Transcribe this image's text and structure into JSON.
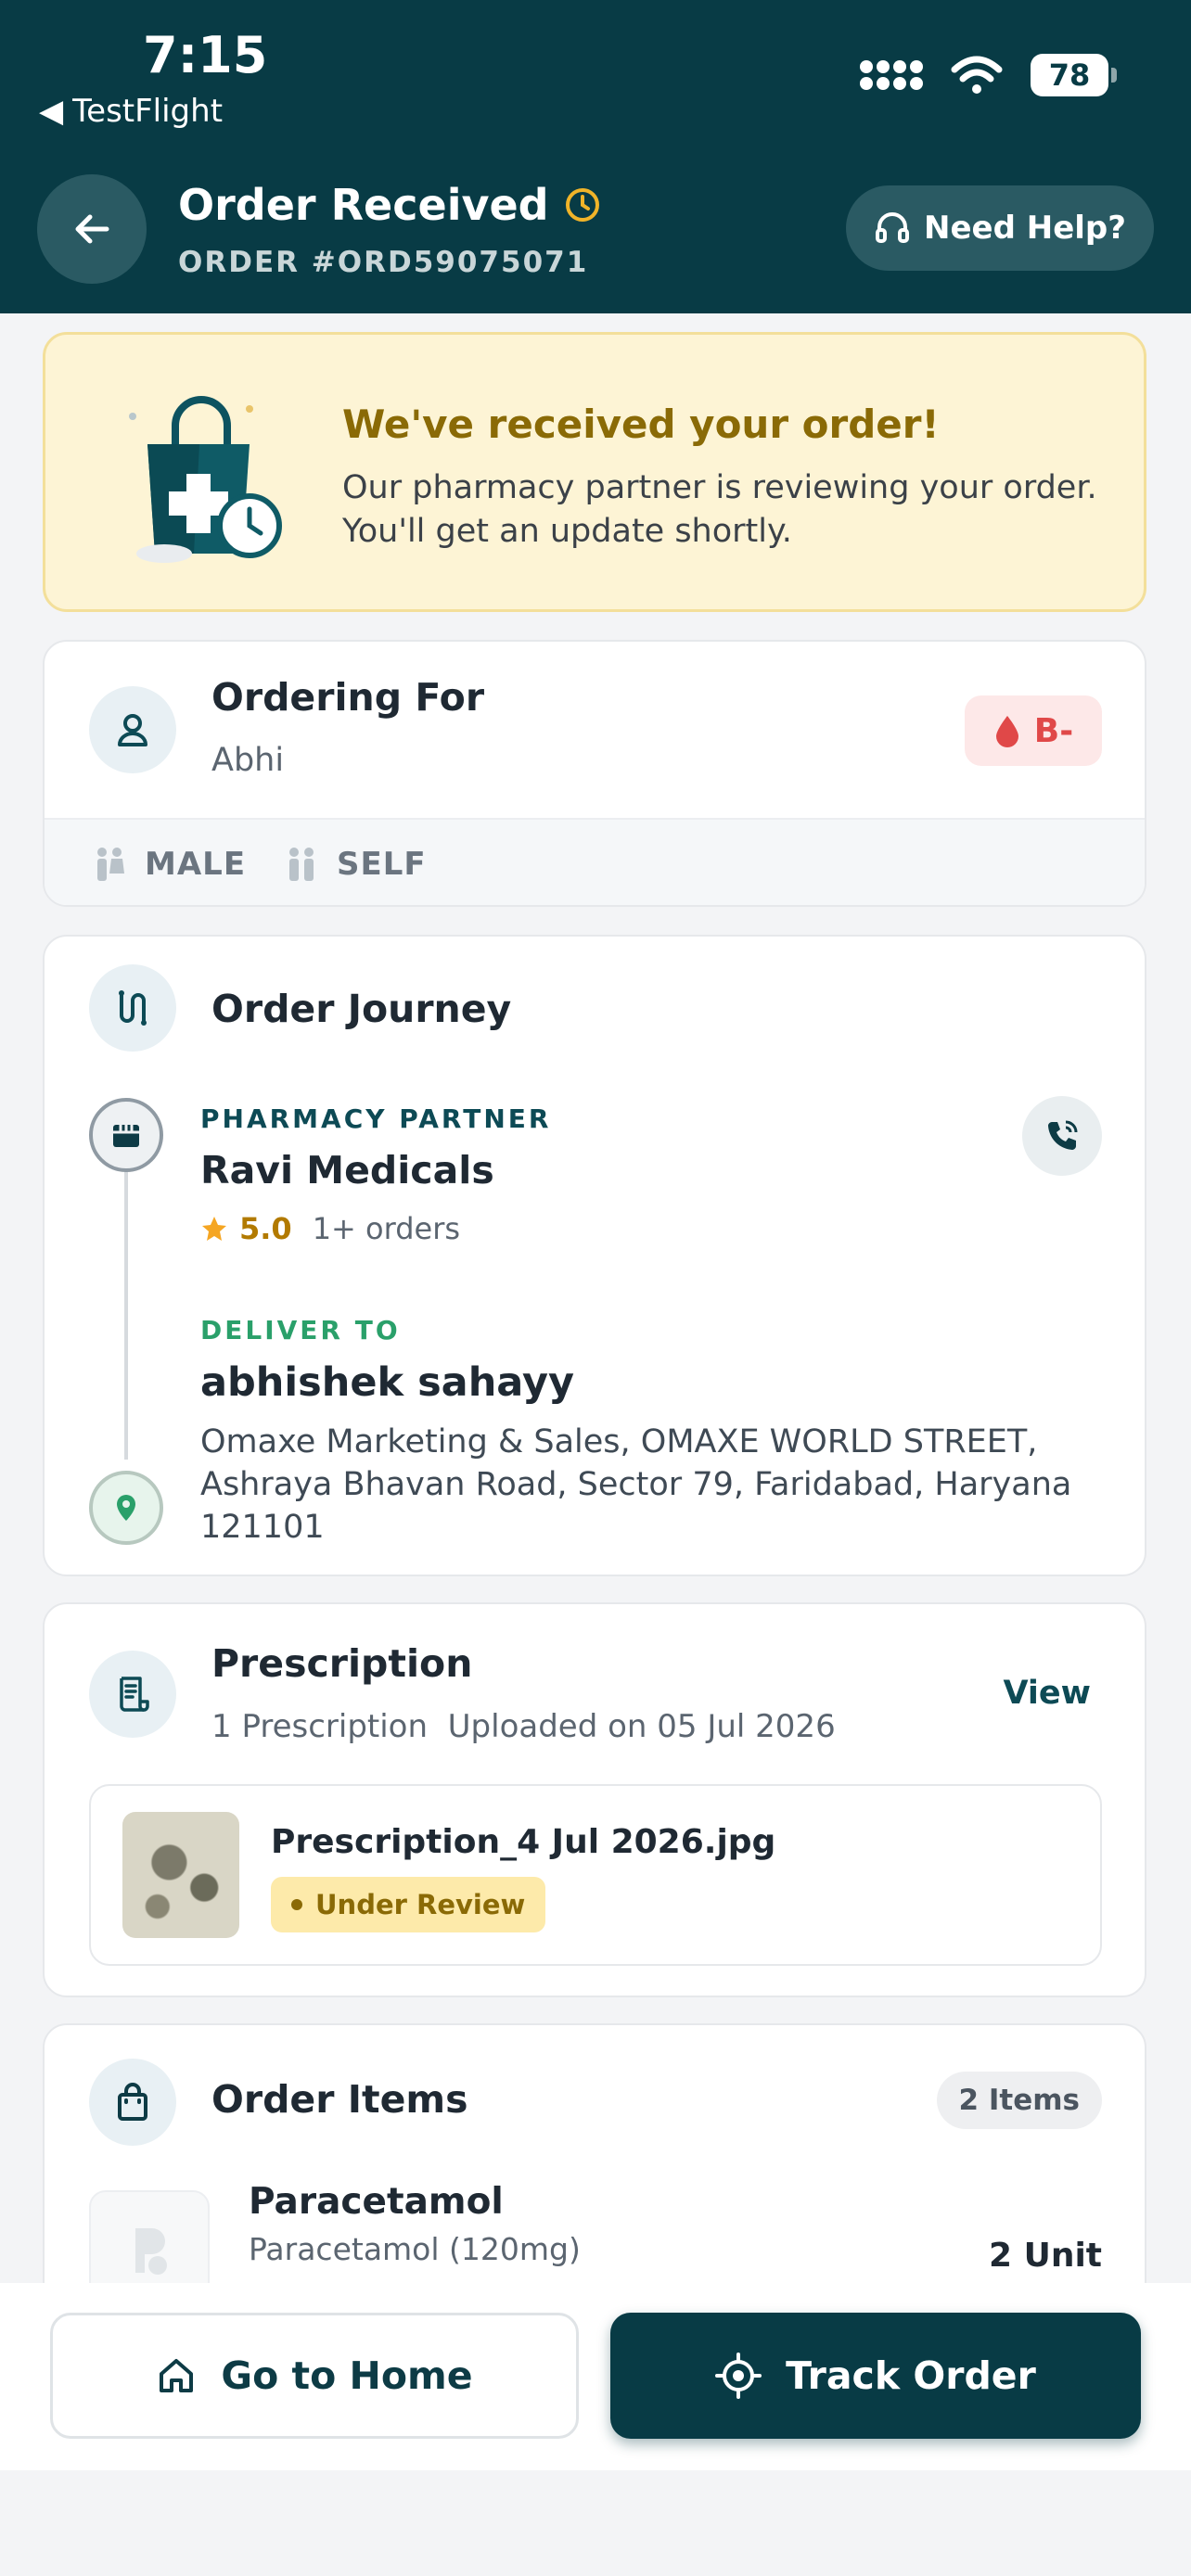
{
  "status_bar": {
    "time": "7:15",
    "back_app": "TestFlight",
    "battery": "78"
  },
  "header": {
    "title": "Order Received",
    "order_id": "ORDER #ORD59075071",
    "help_label": "Need Help?"
  },
  "banner": {
    "title": "We've received your order!",
    "text": "Our pharmacy partner is reviewing your order. You'll get an update shortly."
  },
  "ordering_for": {
    "title": "Ordering For",
    "name": "Abhi",
    "blood_group": "B-",
    "gender": "MALE",
    "relation": "SELF"
  },
  "journey": {
    "title": "Order Journey",
    "pharmacy_label": "PHARMACY PARTNER",
    "pharmacy_name": "Ravi Medicals",
    "rating": "5.0",
    "orders": "1+ orders",
    "deliver_label": "DELIVER TO",
    "deliver_name": "abhishek sahayy",
    "deliver_address": "Omaxe Marketing & Sales, OMAXE WORLD STREET, Ashraya Bhavan Road, Sector 79, Faridabad, Haryana 121101"
  },
  "prescription": {
    "title": "Prescription",
    "count": "1 Prescription",
    "uploaded": "Uploaded on 05 Jul 2026",
    "view_label": "View",
    "file_name": "Prescription_4 Jul 2026.jpg",
    "status": "Under Review"
  },
  "order_items": {
    "title": "Order Items",
    "count": "2 Items",
    "items": [
      {
        "name": "Paracetamol",
        "desc": "Paracetamol (120mg)",
        "qty": "2 Unit"
      }
    ]
  },
  "actions": {
    "home": "Go to Home",
    "track": "Track Order"
  },
  "colors": {
    "primary": "#083b45",
    "banner_bg": "#fdf4d5",
    "accent_gold": "#8a6a06",
    "deliver_green": "#2aa06a",
    "blood_red": "#e04848"
  }
}
